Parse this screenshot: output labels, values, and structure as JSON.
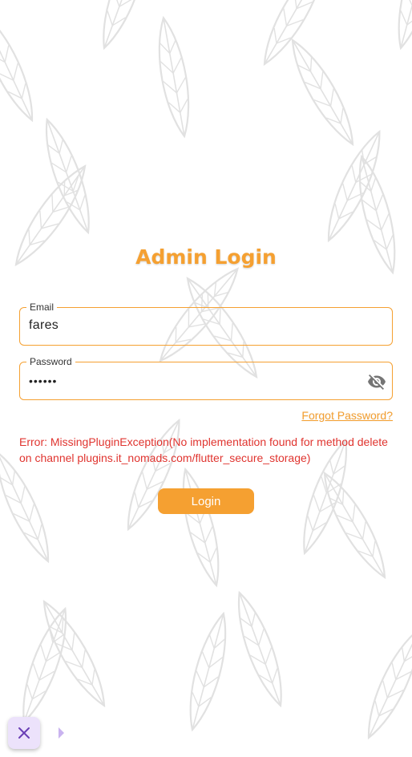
{
  "page": {
    "title": "Admin Login",
    "accent_color": "#f5a031",
    "error_color": "#e0342f"
  },
  "form": {
    "email": {
      "label": "Email",
      "value": "fares"
    },
    "password": {
      "label": "Password",
      "masked_value": "••••••",
      "toggle_icon": "visibility-off-icon"
    },
    "forgot_password": "Forgot Password?",
    "error_message": "Error: MissingPluginException(No implementation found for method delete on channel plugins.it_nomads.com/flutter_secure_storage)",
    "login_button": "Login"
  },
  "overlay": {
    "close_icon": "close-icon",
    "arrow_icon": "arrow-right-icon"
  }
}
